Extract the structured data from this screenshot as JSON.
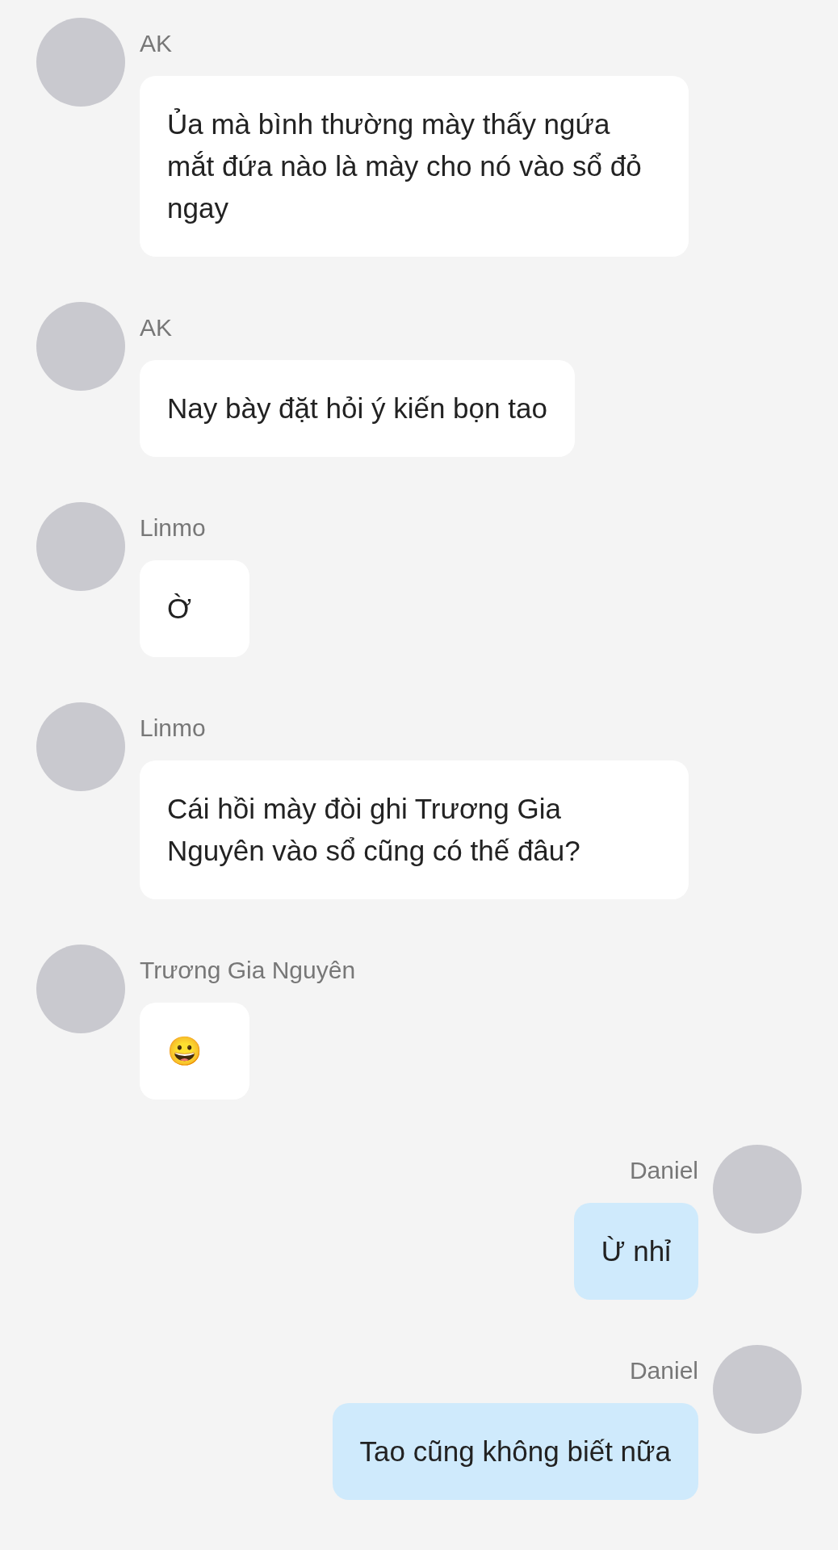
{
  "messages": [
    {
      "kind": "received",
      "sender": "AK",
      "text": "Ủa mà bình thường mày thấy ngứa mắt đứa nào là mày cho nó vào sổ đỏ ngay"
    },
    {
      "kind": "received",
      "sender": "AK",
      "text": "Nay bày đặt hỏi ý kiến bọn tao"
    },
    {
      "kind": "received",
      "sender": "Linmo",
      "text": "Ờ"
    },
    {
      "kind": "received",
      "sender": "Linmo",
      "text": "Cái hồi mày đòi ghi Trương Gia Nguyên vào sổ cũng có thế đâu?"
    },
    {
      "kind": "received",
      "sender": "Trương Gia Nguyên",
      "text": "😀"
    },
    {
      "kind": "sent",
      "sender": "Daniel",
      "text": "Ừ nhỉ"
    },
    {
      "kind": "sent",
      "sender": "Daniel",
      "text": "Tao cũng không biết nữa"
    }
  ]
}
